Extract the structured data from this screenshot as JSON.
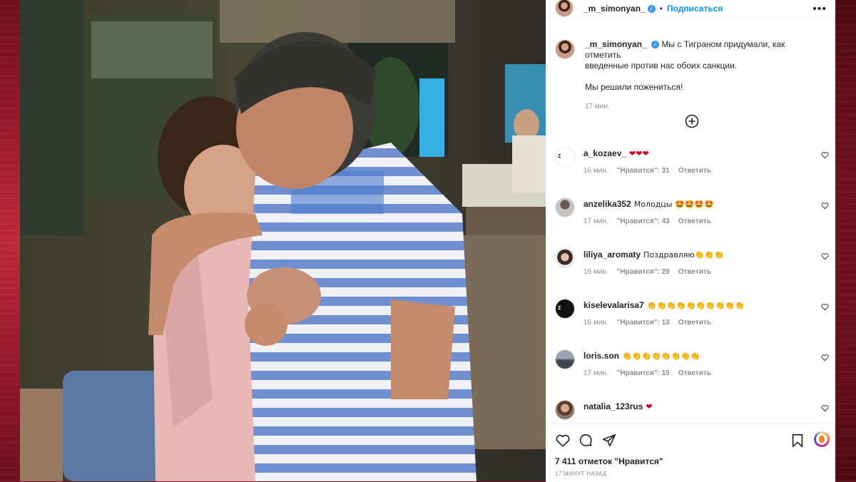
{
  "post": {
    "username": "_m_simonyan_",
    "follow_label": "Подписаться",
    "more_label": "•••",
    "caption_line1": "Мы с Тиграном придумали, как отметить",
    "caption_line2": "введенные против нас обоих санкции.",
    "caption_line3": "Мы решили пожениться!",
    "caption_time": "17 мин.",
    "likes": "7 411 отметок \"Нравится\"",
    "posted": "17 минут назад"
  },
  "comments": [
    {
      "user": "a_kozaev_",
      "text": "❤❤❤",
      "time": "16 мин.",
      "likes": "\"Нравится\": 31",
      "reply": "Ответить",
      "avatar": "z-badge"
    },
    {
      "user": "anzelika352",
      "text": "Молодцы 🤩🤩🤩🤩",
      "time": "17 мин.",
      "likes": "\"Нравится\": 43",
      "reply": "Ответить",
      "avatar": "photo"
    },
    {
      "user": "liliya_aromaty",
      "text": "Поздравляю👏👏👏",
      "time": "16 мин.",
      "likes": "\"Нравится\": 29",
      "reply": "Ответить",
      "avatar": "photo"
    },
    {
      "user": "kiselevalarisa7",
      "text": "👏👏👏👏👏👏👏👏👏👏",
      "time": "16 мин.",
      "likes": "\"Нравится\": 13",
      "reply": "Ответить",
      "avatar": "z-badge"
    },
    {
      "user": "loris.son",
      "text": "👏👏👏👏👏👏👏👏",
      "time": "17 мин.",
      "likes": "\"Нравится\": 15",
      "reply": "Ответить",
      "avatar": "photo"
    },
    {
      "user": "natalia_123rus",
      "text": "❤",
      "time": "",
      "likes": "",
      "reply": "",
      "avatar": "photo"
    }
  ],
  "icons": {
    "verified": "verified-badge-icon",
    "add": "plus-circle-icon",
    "like": "heart-icon",
    "comment": "comment-icon",
    "share": "paper-plane-icon",
    "save": "bookmark-icon"
  },
  "colors": {
    "accent": "#0095f6",
    "verified": "#3897f0",
    "heart": "#d0021b",
    "frame": "#8a1526"
  }
}
